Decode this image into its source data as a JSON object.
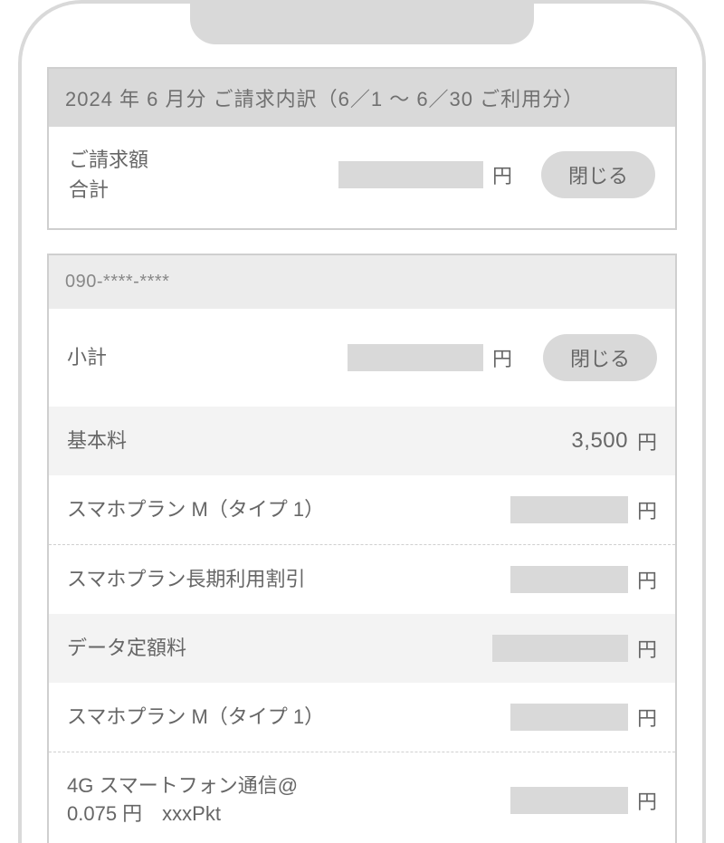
{
  "header": {
    "title": "2024 年  6 月分  ご請求内訳（6／1 〜 6／30 ご利用分）"
  },
  "summary": {
    "label_line1": "ご請求額",
    "label_line2": "合計",
    "yen": "円",
    "close_label": "閉じる"
  },
  "phone_number": "090-****-****",
  "subtotal": {
    "label": "小計",
    "yen": "円",
    "close_label": "閉じる"
  },
  "sections": [
    {
      "category_label": "基本料",
      "category_amount": "3,500",
      "category_yen": "円",
      "items": [
        {
          "label": "スマホプラン M（タイプ 1）",
          "yen": "円"
        },
        {
          "label": "スマホプラン長期利用割引",
          "yen": "円"
        }
      ]
    },
    {
      "category_label": "データ定額料",
      "category_yen": "円",
      "items": [
        {
          "label": "スマホプラン M（タイプ 1）",
          "yen": "円"
        },
        {
          "label": "4G スマートフォン通信@\n0.075 円　xxxPkt",
          "yen": "円"
        }
      ]
    }
  ]
}
